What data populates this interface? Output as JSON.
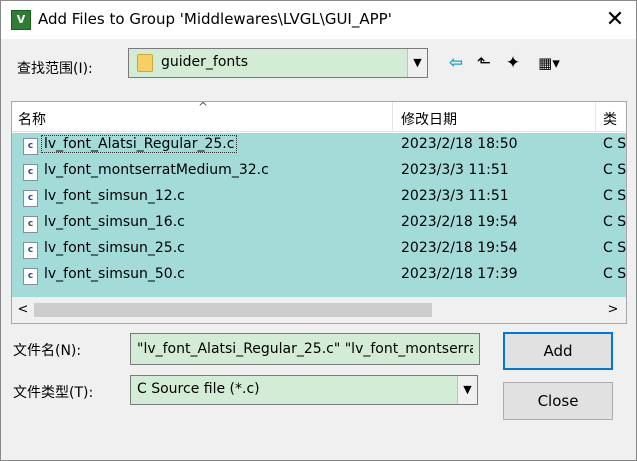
{
  "window": {
    "title": "Add Files to Group 'Middlewares\\LVGL\\GUI_APP'",
    "app_icon_text": "V",
    "close_glyph": "✕"
  },
  "look_in": {
    "label": "查找范围(I):",
    "folder": "guider_fonts",
    "dropdown_glyph": "▼"
  },
  "toolbar": {
    "back_glyph": "⇦",
    "up_glyph": "⬑",
    "new_folder_glyph": "✦",
    "view_menu_glyph": "▦▾"
  },
  "file_list": {
    "columns": {
      "name": "名称",
      "date": "修改日期",
      "type": "类"
    },
    "sort_glyph": "^",
    "icon_glyph": "c",
    "rows": [
      {
        "name": "lv_font_Alatsi_Regular_25.c",
        "date": "2023/2/18 18:50",
        "type": "C S"
      },
      {
        "name": "lv_font_montserratMedium_32.c",
        "date": "2023/3/3 11:51",
        "type": "C S"
      },
      {
        "name": "lv_font_simsun_12.c",
        "date": "2023/3/3 11:51",
        "type": "C S"
      },
      {
        "name": "lv_font_simsun_16.c",
        "date": "2023/2/18 19:54",
        "type": "C S"
      },
      {
        "name": "lv_font_simsun_25.c",
        "date": "2023/2/18 19:54",
        "type": "C S"
      },
      {
        "name": "lv_font_simsun_50.c",
        "date": "2023/2/18 17:39",
        "type": "C S"
      }
    ],
    "scroll_left_glyph": "<",
    "scroll_right_glyph": ">"
  },
  "file_name": {
    "label": "文件名(N):",
    "value": "\"lv_font_Alatsi_Regular_25.c\" \"lv_font_montserrat"
  },
  "file_type": {
    "label": "文件类型(T):",
    "value": "C Source file (*.c)",
    "dropdown_glyph": "▼"
  },
  "buttons": {
    "add": "Add",
    "close": "Close"
  },
  "colors": {
    "selection": "#a2dbd8",
    "field_highlight": "#d2ecd5",
    "default_button_border": "#0078d7"
  }
}
